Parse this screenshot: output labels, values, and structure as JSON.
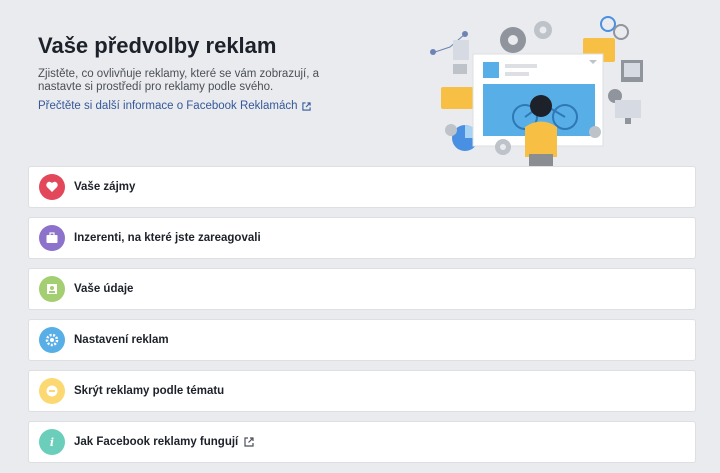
{
  "header": {
    "title": "Vaše předvolby reklam",
    "description": "Zjistěte, co ovlivňuje reklamy, které se vám zobrazují, a nastavte si prostředí pro reklamy podle svého.",
    "learn_more": "Přečtěte si další informace o Facebook Reklamách"
  },
  "items": [
    {
      "label": "Vaše zájmy",
      "icon": "heart-icon",
      "color": "#e2475a"
    },
    {
      "label": "Inzerenti, na které jste zareagovali",
      "icon": "briefcase-icon",
      "color": "#8c72cb"
    },
    {
      "label": "Vaše údaje",
      "icon": "profile-card-icon",
      "color": "#a3ce71"
    },
    {
      "label": "Nastavení reklam",
      "icon": "gear-icon",
      "color": "#58aee6"
    },
    {
      "label": "Skrýt reklamy podle tématu",
      "icon": "minus-icon",
      "color": "#fcd872"
    },
    {
      "label": "Jak Facebook reklamy fungují",
      "icon": "info-icon",
      "color": "#6bcebb"
    }
  ],
  "colors": {
    "background": "#e9ebee",
    "link": "#365899"
  }
}
